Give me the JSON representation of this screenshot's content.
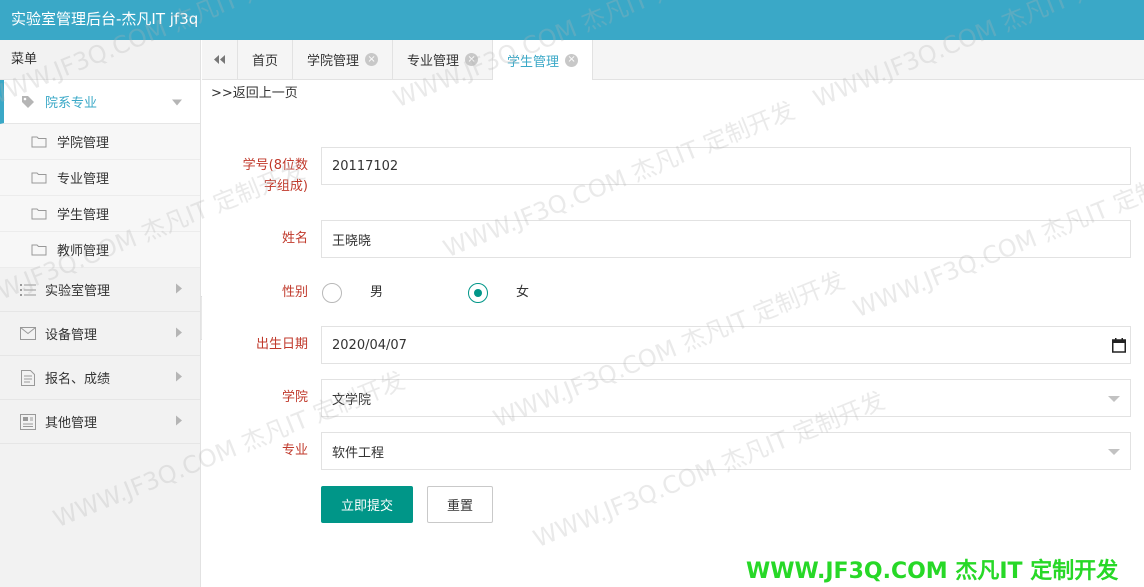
{
  "app": {
    "title": "实验室管理后台-杰凡IT jf3q"
  },
  "sidebar": {
    "header": "菜单",
    "groups": [
      {
        "label": "院系专业",
        "icon": "tag-icon",
        "expanded": true,
        "items": [
          {
            "label": "学院管理",
            "icon": "folder-icon"
          },
          {
            "label": "专业管理",
            "icon": "folder-icon"
          },
          {
            "label": "学生管理",
            "icon": "folder-icon"
          },
          {
            "label": "教师管理",
            "icon": "folder-icon"
          }
        ]
      },
      {
        "label": "实验室管理",
        "icon": "list-icon"
      },
      {
        "label": "设备管理",
        "icon": "mail-icon"
      },
      {
        "label": "报名、成绩",
        "icon": "document-icon"
      },
      {
        "label": "其他管理",
        "icon": "report-icon"
      }
    ]
  },
  "tabs": {
    "items": [
      {
        "label": "首页",
        "closable": false,
        "active": false
      },
      {
        "label": "学院管理",
        "closable": true,
        "active": false
      },
      {
        "label": "专业管理",
        "closable": true,
        "active": false
      },
      {
        "label": "学生管理",
        "closable": true,
        "active": true
      }
    ]
  },
  "page": {
    "back_link": ">>返回上一页"
  },
  "form": {
    "student_id": {
      "label_line1": "学号(8位数",
      "label_line2": "字组成)",
      "value": "20117102"
    },
    "name": {
      "label": "姓名",
      "value": "王晓晓"
    },
    "gender": {
      "label": "性别",
      "options": [
        "男",
        "女"
      ],
      "selected": "女"
    },
    "birth_date": {
      "label": "出生日期",
      "value": "2020/04/07"
    },
    "college": {
      "label": "学院",
      "value": "文学院"
    },
    "major": {
      "label": "专业",
      "value": "软件工程"
    },
    "submit_label": "立即提交",
    "reset_label": "重置"
  },
  "watermark": {
    "text": "WWW.JF3Q.COM 杰凡IT 定制开发"
  },
  "colors": {
    "header": "#3aa8c7",
    "accent": "#3aa8c7",
    "primary_button": "#009688",
    "label_red": "#c0392b",
    "brand_green": "#27d827"
  }
}
